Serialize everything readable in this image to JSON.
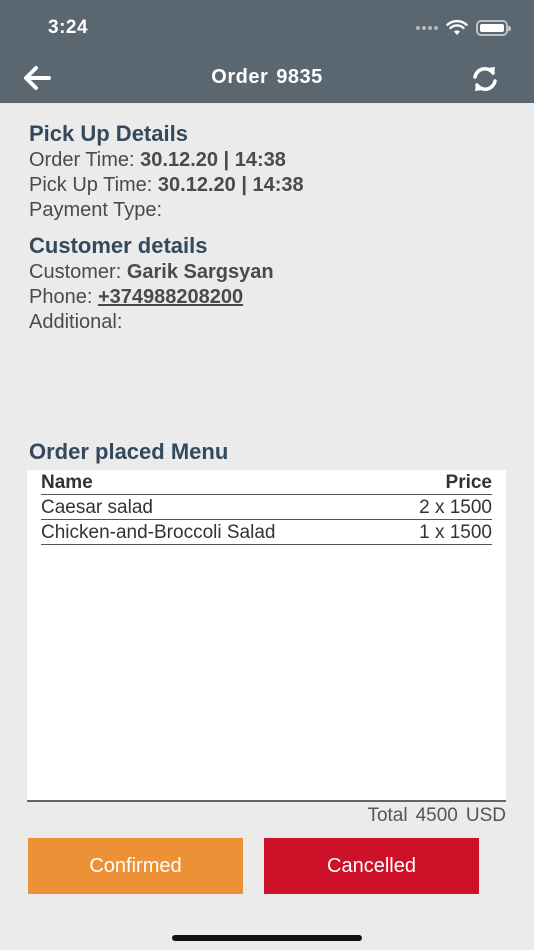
{
  "status": {
    "time": "3:24"
  },
  "header": {
    "title": "Order",
    "order_number": "9835"
  },
  "pickup": {
    "title": "Pick Up Details",
    "order_time_label": "Order Time:",
    "order_time_value": "30.12.20 | 14:38",
    "pickup_time_label": "Pick Up Time:",
    "pickup_time_value": "30.12.20 | 14:38",
    "payment_label": "Payment Type:",
    "payment_value": ""
  },
  "customer": {
    "title": "Customer details",
    "name_label": "Customer:",
    "name_value": "Garik Sargsyan",
    "phone_label": "Phone:",
    "phone_value": "+374988208200",
    "additional_label": "Additional:",
    "additional_value": ""
  },
  "menu": {
    "title": "Order placed Menu",
    "columns": [
      "Name",
      "Price"
    ],
    "rows": [
      {
        "name": "Caesar salad",
        "price": "2 x 1500"
      },
      {
        "name": "Chicken-and-Broccoli Salad",
        "price": "1 x 1500"
      }
    ],
    "total_label": "Total",
    "total_value": "4500",
    "currency": "USD"
  },
  "actions": {
    "confirm_label": "Confirmed",
    "cancel_label": "Cancelled"
  },
  "colors": {
    "header": "#5a6670",
    "heading": "#34495e",
    "confirm": "#ec9135",
    "cancel": "#cd1128"
  },
  "icons": {
    "back": "arrow-left-icon",
    "refresh": "refresh-icon",
    "wifi": "wifi-icon",
    "battery": "battery-icon"
  }
}
